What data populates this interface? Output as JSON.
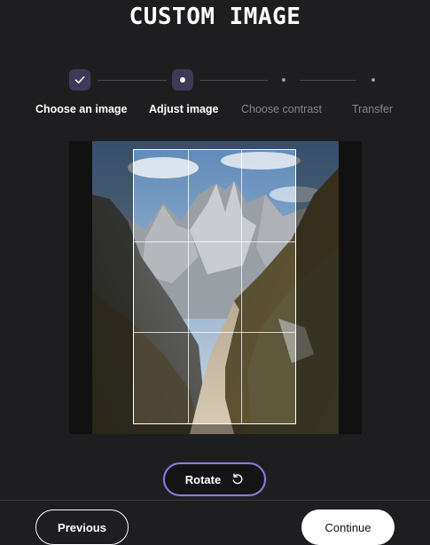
{
  "page": {
    "title": "CUSTOM IMAGE"
  },
  "stepper": {
    "steps": [
      {
        "label": "Choose an image",
        "state": "completed",
        "icon": "check-icon"
      },
      {
        "label": "Adjust image",
        "state": "current",
        "icon": "dot-icon"
      },
      {
        "label": "Choose contrast",
        "state": "upcoming"
      },
      {
        "label": "Transfer",
        "state": "upcoming"
      }
    ]
  },
  "editor": {
    "image_subject": "mountain-trail-photo",
    "crop_grid": "3x3"
  },
  "actions": {
    "rotate_label": "Rotate",
    "rotate_icon": "rotate-ccw-icon",
    "previous_label": "Previous",
    "continue_label": "Continue"
  },
  "colors": {
    "background": "#1e1e20",
    "step_active": "#3d3a58",
    "rotate_border": "#8a7fdc"
  }
}
